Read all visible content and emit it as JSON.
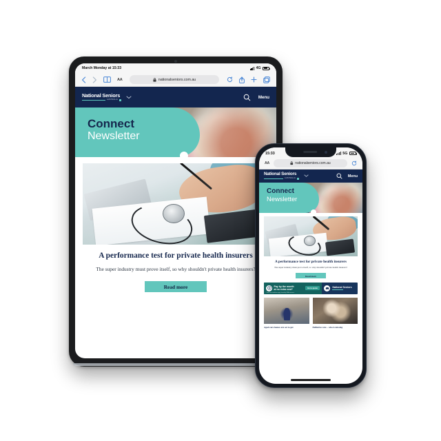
{
  "scene": {
    "description": "Responsive website preview on tablet and phone",
    "background_color": "#ffffff"
  },
  "colors": {
    "brand_navy": "#13264f",
    "brand_teal": "#62c6bc",
    "ad_navy": "#17345c",
    "ad_teal": "#14635f",
    "cta_teal": "#2f9c90"
  },
  "tablet": {
    "status_bar": {
      "time": "March Monday at 15:33",
      "network": "4G",
      "signal_icon": "signal-bars-icon",
      "battery_icon": "battery-icon"
    },
    "browser": {
      "back_icon": "chevron-left-icon",
      "forward_icon": "chevron-right-icon",
      "bookmarks_icon": "book-icon",
      "text_size_label": "AA",
      "lock_icon": "lock-icon",
      "url": "nationalseniors.com.au",
      "reload_icon": "reload-icon",
      "share_icon": "share-icon",
      "new_tab_icon": "plus-icon",
      "tabs_icon": "tabs-icon"
    },
    "site_header": {
      "logo_name": "National Seniors",
      "logo_subtitle": "AUSTRALIA",
      "dropdown_icon": "chevron-down-icon",
      "search_icon": "search-icon",
      "menu_label": "Menu"
    },
    "hero": {
      "line1": "Connect",
      "line2": "Newsletter"
    },
    "article": {
      "image_alt": "hands-writing-with-calculator-and-stethoscope",
      "title": "A performance test for private health insurers",
      "subtitle": "The super industry must prove itself, so why shouldn't private health insurers?",
      "read_more_label": "Read more"
    }
  },
  "phone": {
    "status_bar": {
      "time": "15:33",
      "network": "5G",
      "signal_icon": "signal-bars-icon",
      "battery_icon": "battery-icon"
    },
    "browser": {
      "text_size_label": "AA",
      "lock_icon": "lock-icon",
      "url": "nationalseniors.com.au",
      "reload_icon": "reload-icon"
    },
    "site_header": {
      "logo_name": "National Seniors",
      "logo_subtitle": "AUSTRALIA",
      "dropdown_icon": "chevron-down-icon",
      "search_icon": "search-icon",
      "menu_label": "Menu"
    },
    "hero": {
      "line1": "Connect",
      "line2": "Newsletter"
    },
    "article": {
      "image_alt": "hands-writing-with-calculator-and-stethoscope",
      "title": "A performance test for private health insurers",
      "subtitle": "The super industry must prove itself, so why shouldn't private health insurers?",
      "read_more_label": "Read more"
    },
    "ad_banner": {
      "badge_icon": "car-insurance-icon",
      "headline_line1": "Pay by the month",
      "headline_line2": "at no extra cost*",
      "cta_label": "Get a quote",
      "fine_print": "*Terms and conditions apply. Issued by NSA Insurance.",
      "car_icon": "car-icon",
      "logo_name": "National Seniors",
      "logo_subtitle": "AUSTRALIA"
    },
    "cards": [
      {
        "image_alt": "elderly-person-walking-with-frame-in-aged-care-corridor",
        "title": "Aged care homes are set to get"
      },
      {
        "image_alt": "carer-comforting-elderly-woman-in-chair",
        "title": "Palliative care – who is missing"
      }
    ]
  }
}
